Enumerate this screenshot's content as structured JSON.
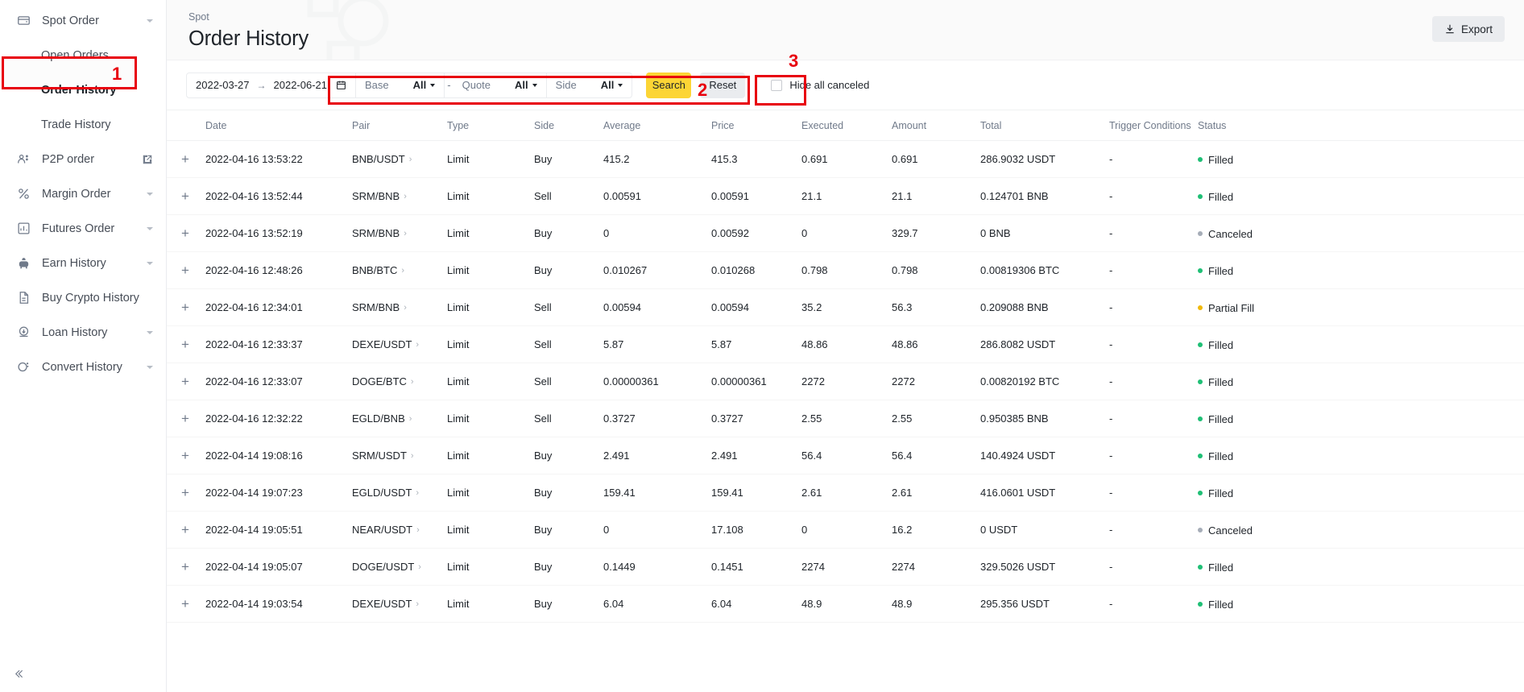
{
  "sidebar": {
    "items": [
      {
        "label": "Spot Order",
        "icon": "wallet-icon",
        "caret": true,
        "sub": false,
        "active": false
      },
      {
        "label": "Open Orders",
        "icon": null,
        "caret": false,
        "sub": true,
        "active": false
      },
      {
        "label": "Order History",
        "icon": null,
        "caret": false,
        "sub": true,
        "active": true
      },
      {
        "label": "Trade History",
        "icon": null,
        "caret": false,
        "sub": true,
        "active": false
      },
      {
        "label": "P2P order",
        "icon": "people-icon",
        "caret": false,
        "external": true,
        "sub": false,
        "active": false
      },
      {
        "label": "Margin Order",
        "icon": "percent-icon",
        "caret": true,
        "sub": false,
        "active": false
      },
      {
        "label": "Futures Order",
        "icon": "chart-box-icon",
        "caret": true,
        "sub": false,
        "active": false
      },
      {
        "label": "Earn History",
        "icon": "piggy-bank-icon",
        "caret": true,
        "sub": false,
        "active": false
      },
      {
        "label": "Buy Crypto History",
        "icon": "document-icon",
        "caret": false,
        "sub": false,
        "active": false
      },
      {
        "label": "Loan History",
        "icon": "loan-icon",
        "caret": true,
        "sub": false,
        "active": false
      },
      {
        "label": "Convert History",
        "icon": "convert-icon",
        "caret": true,
        "sub": false,
        "active": false
      }
    ],
    "collapse_icon": "collapse-left-icon"
  },
  "header": {
    "breadcrumb": "Spot",
    "title": "Order History",
    "export_label": "Export",
    "export_icon": "download-icon"
  },
  "filters": {
    "date_from": "2022-03-27",
    "date_to": "2022-06-21",
    "date_arrow": "→",
    "calendar_icon": "calendar-icon",
    "base_label": "Base",
    "base_value": "All",
    "separator": "-",
    "quote_label": "Quote",
    "quote_value": "All",
    "side_label": "Side",
    "side_value": "All",
    "search_label": "Search",
    "reset_label": "Reset",
    "hide_canceled_label": "Hide all canceled",
    "hide_canceled_checked": false
  },
  "annotations": {
    "marker1": "1",
    "marker2": "2",
    "marker3": "3",
    "color": "#e8000d"
  },
  "table": {
    "columns": [
      "",
      "Date",
      "Pair",
      "Type",
      "Side",
      "Average",
      "Price",
      "Executed",
      "Amount",
      "Total",
      "Trigger Conditions",
      "Status"
    ],
    "expand_icon": "plus-icon",
    "pair_chevron_icon": "chevron-right-icon",
    "rows": [
      {
        "date": "2022-04-16 13:53:22",
        "pair": "BNB/USDT",
        "type": "Limit",
        "side": "Buy",
        "average": "415.2",
        "price": "415.3",
        "executed": "0.691",
        "amount": "0.691",
        "total": "286.9032 USDT",
        "trigger": "-",
        "status": "Filled",
        "status_kind": "filled"
      },
      {
        "date": "2022-04-16 13:52:44",
        "pair": "SRM/BNB",
        "type": "Limit",
        "side": "Sell",
        "average": "0.00591",
        "price": "0.00591",
        "executed": "21.1",
        "amount": "21.1",
        "total": "0.124701 BNB",
        "trigger": "-",
        "status": "Filled",
        "status_kind": "filled"
      },
      {
        "date": "2022-04-16 13:52:19",
        "pair": "SRM/BNB",
        "type": "Limit",
        "side": "Buy",
        "average": "0",
        "price": "0.00592",
        "executed": "0",
        "amount": "329.7",
        "total": "0 BNB",
        "trigger": "-",
        "status": "Canceled",
        "status_kind": "canceled"
      },
      {
        "date": "2022-04-16 12:48:26",
        "pair": "BNB/BTC",
        "type": "Limit",
        "side": "Buy",
        "average": "0.010267",
        "price": "0.010268",
        "executed": "0.798",
        "amount": "0.798",
        "total": "0.00819306 BTC",
        "trigger": "-",
        "status": "Filled",
        "status_kind": "filled"
      },
      {
        "date": "2022-04-16 12:34:01",
        "pair": "SRM/BNB",
        "type": "Limit",
        "side": "Sell",
        "average": "0.00594",
        "price": "0.00594",
        "executed": "35.2",
        "amount": "56.3",
        "total": "0.209088 BNB",
        "trigger": "-",
        "status": "Partial Fill",
        "status_kind": "partial"
      },
      {
        "date": "2022-04-16 12:33:37",
        "pair": "DEXE/USDT",
        "type": "Limit",
        "side": "Sell",
        "average": "5.87",
        "price": "5.87",
        "executed": "48.86",
        "amount": "48.86",
        "total": "286.8082 USDT",
        "trigger": "-",
        "status": "Filled",
        "status_kind": "filled"
      },
      {
        "date": "2022-04-16 12:33:07",
        "pair": "DOGE/BTC",
        "type": "Limit",
        "side": "Sell",
        "average": "0.00000361",
        "price": "0.00000361",
        "executed": "2272",
        "amount": "2272",
        "total": "0.00820192 BTC",
        "trigger": "-",
        "status": "Filled",
        "status_kind": "filled"
      },
      {
        "date": "2022-04-16 12:32:22",
        "pair": "EGLD/BNB",
        "type": "Limit",
        "side": "Sell",
        "average": "0.3727",
        "price": "0.3727",
        "executed": "2.55",
        "amount": "2.55",
        "total": "0.950385 BNB",
        "trigger": "-",
        "status": "Filled",
        "status_kind": "filled"
      },
      {
        "date": "2022-04-14 19:08:16",
        "pair": "SRM/USDT",
        "type": "Limit",
        "side": "Buy",
        "average": "2.491",
        "price": "2.491",
        "executed": "56.4",
        "amount": "56.4",
        "total": "140.4924 USDT",
        "trigger": "-",
        "status": "Filled",
        "status_kind": "filled"
      },
      {
        "date": "2022-04-14 19:07:23",
        "pair": "EGLD/USDT",
        "type": "Limit",
        "side": "Buy",
        "average": "159.41",
        "price": "159.41",
        "executed": "2.61",
        "amount": "2.61",
        "total": "416.0601 USDT",
        "trigger": "-",
        "status": "Filled",
        "status_kind": "filled"
      },
      {
        "date": "2022-04-14 19:05:51",
        "pair": "NEAR/USDT",
        "type": "Limit",
        "side": "Buy",
        "average": "0",
        "price": "17.108",
        "executed": "0",
        "amount": "16.2",
        "total": "0 USDT",
        "trigger": "-",
        "status": "Canceled",
        "status_kind": "canceled"
      },
      {
        "date": "2022-04-14 19:05:07",
        "pair": "DOGE/USDT",
        "type": "Limit",
        "side": "Buy",
        "average": "0.1449",
        "price": "0.1451",
        "executed": "2274",
        "amount": "2274",
        "total": "329.5026 USDT",
        "trigger": "-",
        "status": "Filled",
        "status_kind": "filled"
      },
      {
        "date": "2022-04-14 19:03:54",
        "pair": "DEXE/USDT",
        "type": "Limit",
        "side": "Buy",
        "average": "6.04",
        "price": "6.04",
        "executed": "48.9",
        "amount": "48.9",
        "total": "295.356 USDT",
        "trigger": "-",
        "status": "Filled",
        "status_kind": "filled"
      }
    ]
  }
}
